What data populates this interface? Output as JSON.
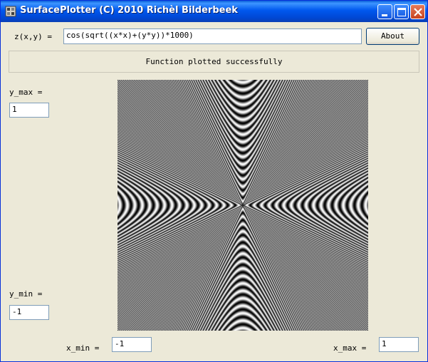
{
  "window": {
    "title": "SurfacePlotter (C) 2010 Richèl Bilderbeek",
    "titlebar_color": "#0054e3"
  },
  "formula": {
    "label": "z(x,y) =",
    "value": "cos(sqrt((x*x)+(y*y))*1000)"
  },
  "about_button": {
    "label": "About"
  },
  "status": {
    "text": "Function plotted successfully"
  },
  "y_max": {
    "label": "y_max =",
    "value": "1"
  },
  "y_min": {
    "label": "y_min =",
    "value": "-1"
  },
  "x_min": {
    "label": "x_min =",
    "value": "-1"
  },
  "x_max": {
    "label": "x_max =",
    "value": "1"
  },
  "plot": {
    "colors": [
      "#000000",
      "#ffffff"
    ]
  },
  "icons": [
    "app-icon",
    "minimize-icon",
    "maximize-icon",
    "close-icon"
  ]
}
